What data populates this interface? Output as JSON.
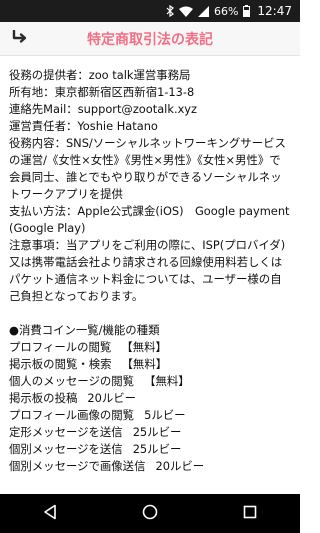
{
  "status_bar": {
    "battery_percent": "66%",
    "time": "12:47",
    "icons": [
      "bluetooth-icon",
      "wifi-icon",
      "cell-signal-icon",
      "battery-icon"
    ]
  },
  "header": {
    "title": "特定商取引法の表記",
    "back_icon": "back-arrow-icon",
    "accent_color": "#f26f84"
  },
  "info_lines": [
    "役務の提供者：zoo talk運営事務局",
    "所有地：東京都新宿区西新宿1-13-8",
    "連絡先Mail：support@zootalk.xyz",
    "運営責任者：Yoshie Hatano",
    "役務内容：SNS/ソーシャルネットワーキングサービスの運営/《女性×女性》《男性×男性》《女性×男性》で会員同士、誰とでもやり取りができるソーシャルネットワークアプリを提供",
    "支払い方法：Apple公式課金(iOS)　Google payment(Google Play)",
    "注意事項：当アプリをご利用の際に、ISP(プロバイダ)又は携帯電話会社より請求される回線使用料若しくはパケット通信ネット料金については、ユーザー様の自己負担となっております。"
  ],
  "coins": {
    "heading": "●消費コイン一覧/機能の種類",
    "items": [
      {
        "name": "プロフィールの閲覧",
        "cost": "【無料】"
      },
      {
        "name": "掲示板の閲覧・検索",
        "cost": "【無料】"
      },
      {
        "name": "個人のメッセージの閲覧",
        "cost": "【無料】"
      },
      {
        "name": "掲示板の投稿",
        "cost": "20ルビー"
      },
      {
        "name": "プロフィール画像の閲覧",
        "cost": "5ルビー"
      },
      {
        "name": "定形メッセージを送信",
        "cost": "25ルビー"
      },
      {
        "name": "個別メッセージを送信",
        "cost": "25ルビー"
      },
      {
        "name": "個別メッセージで画像送信",
        "cost": "20ルビー"
      }
    ]
  },
  "nav_bar": {
    "icons": [
      "nav-back-icon",
      "nav-home-icon",
      "nav-recents-icon"
    ]
  }
}
